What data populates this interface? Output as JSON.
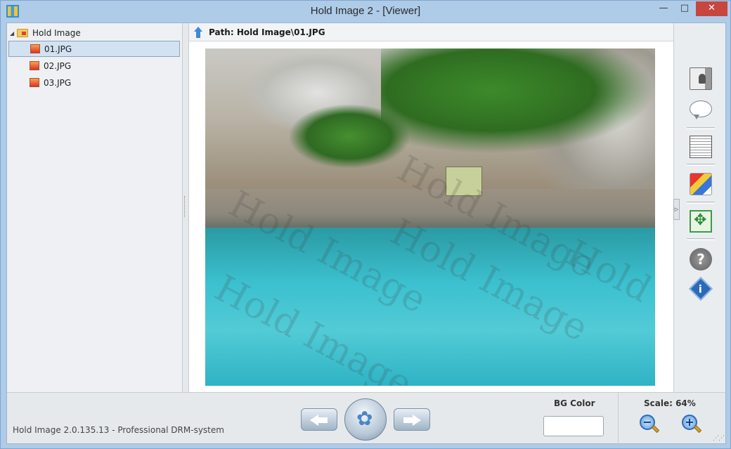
{
  "window": {
    "title": "Hold Image 2 - [Viewer]",
    "minimize_glyph": "—",
    "maximize_glyph": "□",
    "close_glyph": "✕"
  },
  "tree": {
    "root_label": "Hold Image",
    "items": [
      {
        "label": "01.JPG",
        "selected": true
      },
      {
        "label": "02.JPG",
        "selected": false
      },
      {
        "label": "03.JPG",
        "selected": false
      }
    ]
  },
  "viewer": {
    "path_label": "Path: Hold Image\\01.JPG",
    "watermark_text": "Hold Image"
  },
  "right_toolbar": {
    "help_glyph": "?",
    "info_glyph": "i",
    "collapse_glyph": "▷"
  },
  "bottom": {
    "status_text": "Hold Image 2.0.135.13 - Professional DRM-system",
    "bg_color_label": "BG Color",
    "bg_color_value": "#ffffff",
    "scale_label": "Scale: 64%",
    "zoom_out_glyph": "−",
    "zoom_in_glyph": "+"
  },
  "colors": {
    "accent": "#3f88d6",
    "close_button": "#c7463e",
    "selection": "#d3e2f1"
  }
}
